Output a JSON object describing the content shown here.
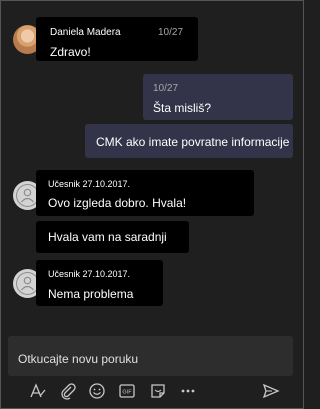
{
  "messages": [
    {
      "sender": "Daniela Madera",
      "time": "10/27",
      "text": "Zdravo!"
    },
    {
      "time": "10/27",
      "text": "Šta misliš?"
    },
    {
      "text": "CMK ako imate povratne informacije"
    },
    {
      "sender": "Učesnik 27.10.2017.",
      "text": "Ovo izgleda dobro. Hvala!"
    },
    {
      "text": "Hvala vam na saradnji"
    },
    {
      "sender": "Učesnik 27.10.2017.",
      "text": "Nema problema"
    }
  ],
  "compose": {
    "placeholder": "Otkucajte novu poruku"
  },
  "toolbar": {
    "icons": [
      "format-icon",
      "attach-icon",
      "emoji-icon",
      "gif-icon",
      "sticker-icon",
      "more-icon",
      "send-icon"
    ],
    "gif_label": "GIF"
  },
  "colors": {
    "background": "#1f1f1f",
    "incoming_bubble": "#000000",
    "outgoing_bubble": "#33344a",
    "compose_bg": "#2d2d2d"
  }
}
